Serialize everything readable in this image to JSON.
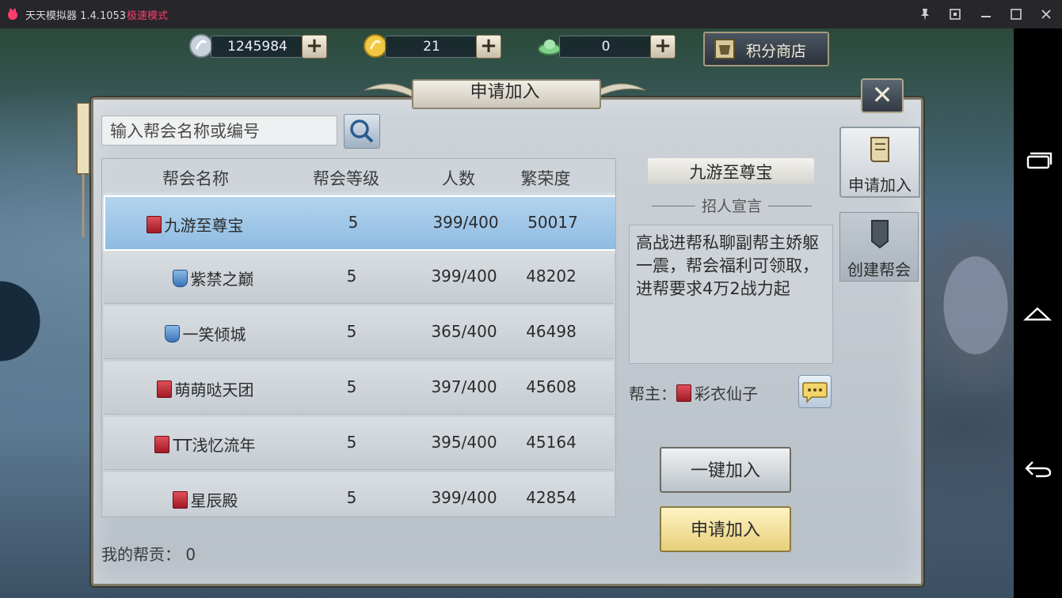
{
  "window": {
    "app_title": "天天模拟器 1.4.1053",
    "mode": "极速模式"
  },
  "currency": {
    "silver": "1245984",
    "gold": "21",
    "jade": "0",
    "shop_label": "积分商店"
  },
  "dialog": {
    "title": "申请加入",
    "close_label": "✕"
  },
  "search": {
    "placeholder": "输入帮会名称或编号"
  },
  "table": {
    "headers": [
      "帮会名称",
      "帮会等级",
      "人数",
      "繁荣度"
    ],
    "rows": [
      {
        "name": "九游至尊宝",
        "level": "5",
        "members": "399/400",
        "prosperity": "50017",
        "badge": "red"
      },
      {
        "name": "紫禁之巅",
        "level": "5",
        "members": "399/400",
        "prosperity": "48202",
        "badge": "blue"
      },
      {
        "name": "一笑倾城",
        "level": "5",
        "members": "365/400",
        "prosperity": "46498",
        "badge": "blue"
      },
      {
        "name": "萌萌哒天团",
        "level": "5",
        "members": "397/400",
        "prosperity": "45608",
        "badge": "red"
      },
      {
        "name": "TT浅忆流年",
        "level": "5",
        "members": "395/400",
        "prosperity": "45164",
        "badge": "red"
      },
      {
        "name": "星辰殿",
        "level": "5",
        "members": "399/400",
        "prosperity": "42854",
        "badge": "red"
      }
    ]
  },
  "my_contribution": "我的帮贡：  0",
  "detail": {
    "guild_name": "九游至尊宝",
    "recruit_title": "招人宣言",
    "manifesto": "高战进帮私聊副帮主娇躯一震，帮会福利可领取，进帮要求4万2战力起",
    "leader_label": "帮主：",
    "leader_name": "彩衣仙子"
  },
  "buttons": {
    "quick_join": "一键加入",
    "apply_join": "申请加入"
  },
  "tabs": {
    "apply": "申请加入",
    "create": "创建帮会"
  },
  "colors": {
    "selected_row": "#9cc6e8",
    "apply_button": "#f0dc8c",
    "badge_red": "#c0303a",
    "badge_blue": "#4a86c8",
    "mode_text": "#ff3d6b"
  }
}
